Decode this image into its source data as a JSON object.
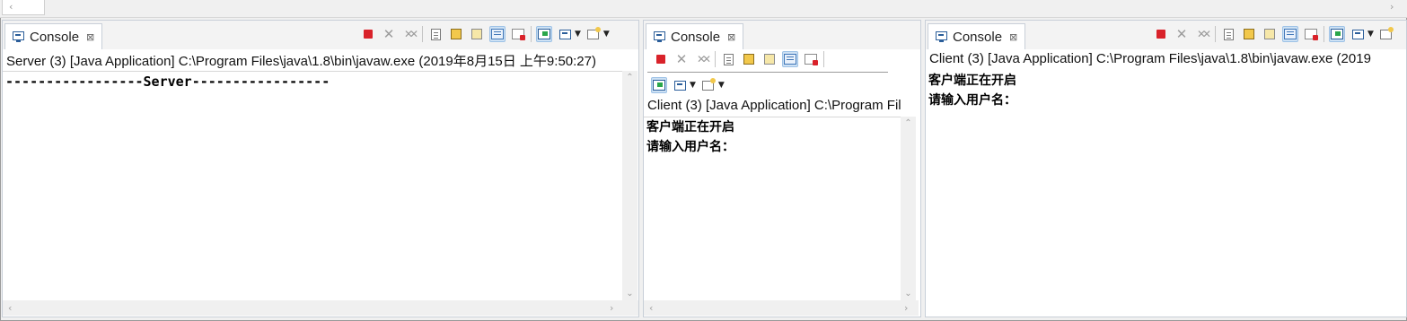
{
  "top_bar": {
    "left_arrow": "‹",
    "right_arrow": "›"
  },
  "panes": {
    "server": {
      "tab_label": "Console",
      "tab_close": "⊠",
      "process_line": "Server (3) [Java Application] C:\\Program Files\\java\\1.8\\bin\\javaw.exe (2019年8月15日 上午9:50:27)",
      "output": [
        "-----------------Server-----------------"
      ]
    },
    "client_middle": {
      "tab_label": "Console",
      "tab_close": "⊠",
      "process_line": "Client (3) [Java Application] C:\\Program Fil",
      "output": [
        "客户端正在开启",
        "请输入用户名："
      ]
    },
    "client_right": {
      "tab_label": "Console",
      "tab_close": "⊠",
      "process_line": "Client (3) [Java Application] C:\\Program Files\\java\\1.8\\bin\\javaw.exe (2019",
      "output": [
        "客户端正在开启",
        "请输入用户名："
      ]
    }
  },
  "scroll_glyphs": {
    "up": "⌃",
    "down": "⌄",
    "left": "‹",
    "right": "›"
  },
  "icons": {
    "terminate": "stop-icon",
    "remove": "remove-launch-icon",
    "remove_all": "remove-all-icon",
    "clear": "clear-console-icon",
    "scroll_lock": "scroll-lock-icon",
    "word_wrap": "word-wrap-icon",
    "show_stdout": "show-stdout-icon",
    "show_stderr": "show-stderr-icon",
    "pin": "pin-console-icon",
    "display": "display-console-icon",
    "open_new": "open-console-icon"
  },
  "colors": {
    "terminate": "#d9222a",
    "selected_toggle": "#cde1f4",
    "border": "#c8cfd8"
  }
}
